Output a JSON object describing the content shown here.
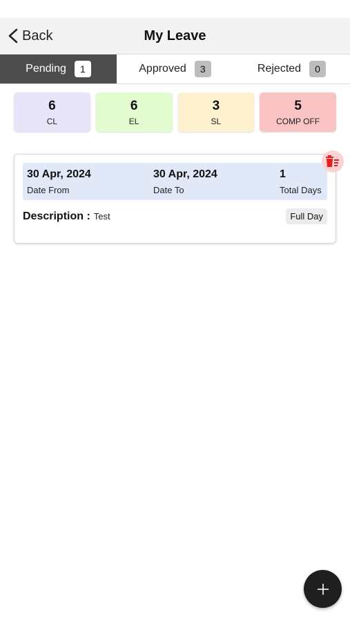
{
  "header": {
    "back_label": "Back",
    "title": "My Leave"
  },
  "tabs": [
    {
      "label": "Pending",
      "count": "1",
      "active": true
    },
    {
      "label": "Approved",
      "count": "3",
      "active": false
    },
    {
      "label": "Rejected",
      "count": "0",
      "active": false
    }
  ],
  "leave_counts": [
    {
      "value": "6",
      "label": "CL",
      "color": "#e8e4fa"
    },
    {
      "value": "6",
      "label": "EL",
      "color": "#e2fbcf"
    },
    {
      "value": "3",
      "label": "SL",
      "color": "#fdf1cf"
    },
    {
      "value": "5",
      "label": "COMP OFF",
      "color": "#fbc4c4"
    }
  ],
  "leave_item": {
    "date_from": "30 Apr, 2024",
    "date_from_label": "Date From",
    "date_to": "30 Apr, 2024",
    "date_to_label": "Date To",
    "total_days": "1",
    "total_days_label": "Total Days",
    "description_label": "Description :",
    "description": "Test",
    "day_type": "Full Day"
  },
  "colors": {
    "active_tab": "#4d4d4d",
    "delete_icon": "#e52020",
    "fab": "#1f1f1f"
  },
  "icons": {
    "back": "chevron-left-icon",
    "delete": "delete-icon",
    "fab": "plus-icon"
  }
}
